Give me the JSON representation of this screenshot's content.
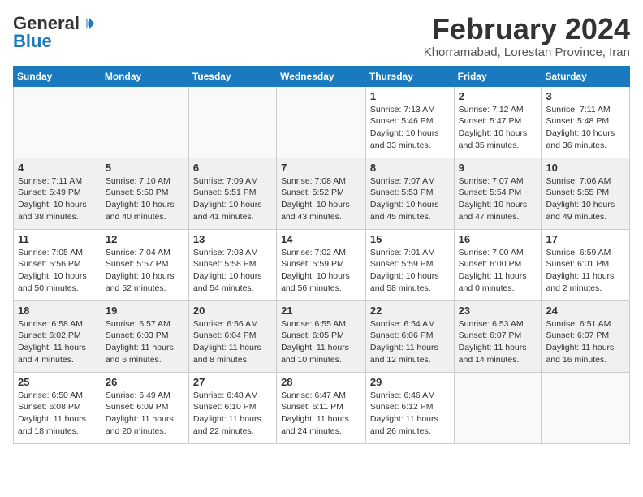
{
  "header": {
    "logo_line1": "General",
    "logo_line2": "Blue",
    "month_year": "February 2024",
    "location": "Khorramabad, Lorestan Province, Iran"
  },
  "weekdays": [
    "Sunday",
    "Monday",
    "Tuesday",
    "Wednesday",
    "Thursday",
    "Friday",
    "Saturday"
  ],
  "weeks": [
    [
      {
        "day": "",
        "info": ""
      },
      {
        "day": "",
        "info": ""
      },
      {
        "day": "",
        "info": ""
      },
      {
        "day": "",
        "info": ""
      },
      {
        "day": "1",
        "info": "Sunrise: 7:13 AM\nSunset: 5:46 PM\nDaylight: 10 hours\nand 33 minutes."
      },
      {
        "day": "2",
        "info": "Sunrise: 7:12 AM\nSunset: 5:47 PM\nDaylight: 10 hours\nand 35 minutes."
      },
      {
        "day": "3",
        "info": "Sunrise: 7:11 AM\nSunset: 5:48 PM\nDaylight: 10 hours\nand 36 minutes."
      }
    ],
    [
      {
        "day": "4",
        "info": "Sunrise: 7:11 AM\nSunset: 5:49 PM\nDaylight: 10 hours\nand 38 minutes."
      },
      {
        "day": "5",
        "info": "Sunrise: 7:10 AM\nSunset: 5:50 PM\nDaylight: 10 hours\nand 40 minutes."
      },
      {
        "day": "6",
        "info": "Sunrise: 7:09 AM\nSunset: 5:51 PM\nDaylight: 10 hours\nand 41 minutes."
      },
      {
        "day": "7",
        "info": "Sunrise: 7:08 AM\nSunset: 5:52 PM\nDaylight: 10 hours\nand 43 minutes."
      },
      {
        "day": "8",
        "info": "Sunrise: 7:07 AM\nSunset: 5:53 PM\nDaylight: 10 hours\nand 45 minutes."
      },
      {
        "day": "9",
        "info": "Sunrise: 7:07 AM\nSunset: 5:54 PM\nDaylight: 10 hours\nand 47 minutes."
      },
      {
        "day": "10",
        "info": "Sunrise: 7:06 AM\nSunset: 5:55 PM\nDaylight: 10 hours\nand 49 minutes."
      }
    ],
    [
      {
        "day": "11",
        "info": "Sunrise: 7:05 AM\nSunset: 5:56 PM\nDaylight: 10 hours\nand 50 minutes."
      },
      {
        "day": "12",
        "info": "Sunrise: 7:04 AM\nSunset: 5:57 PM\nDaylight: 10 hours\nand 52 minutes."
      },
      {
        "day": "13",
        "info": "Sunrise: 7:03 AM\nSunset: 5:58 PM\nDaylight: 10 hours\nand 54 minutes."
      },
      {
        "day": "14",
        "info": "Sunrise: 7:02 AM\nSunset: 5:59 PM\nDaylight: 10 hours\nand 56 minutes."
      },
      {
        "day": "15",
        "info": "Sunrise: 7:01 AM\nSunset: 5:59 PM\nDaylight: 10 hours\nand 58 minutes."
      },
      {
        "day": "16",
        "info": "Sunrise: 7:00 AM\nSunset: 6:00 PM\nDaylight: 11 hours\nand 0 minutes."
      },
      {
        "day": "17",
        "info": "Sunrise: 6:59 AM\nSunset: 6:01 PM\nDaylight: 11 hours\nand 2 minutes."
      }
    ],
    [
      {
        "day": "18",
        "info": "Sunrise: 6:58 AM\nSunset: 6:02 PM\nDaylight: 11 hours\nand 4 minutes."
      },
      {
        "day": "19",
        "info": "Sunrise: 6:57 AM\nSunset: 6:03 PM\nDaylight: 11 hours\nand 6 minutes."
      },
      {
        "day": "20",
        "info": "Sunrise: 6:56 AM\nSunset: 6:04 PM\nDaylight: 11 hours\nand 8 minutes."
      },
      {
        "day": "21",
        "info": "Sunrise: 6:55 AM\nSunset: 6:05 PM\nDaylight: 11 hours\nand 10 minutes."
      },
      {
        "day": "22",
        "info": "Sunrise: 6:54 AM\nSunset: 6:06 PM\nDaylight: 11 hours\nand 12 minutes."
      },
      {
        "day": "23",
        "info": "Sunrise: 6:53 AM\nSunset: 6:07 PM\nDaylight: 11 hours\nand 14 minutes."
      },
      {
        "day": "24",
        "info": "Sunrise: 6:51 AM\nSunset: 6:07 PM\nDaylight: 11 hours\nand 16 minutes."
      }
    ],
    [
      {
        "day": "25",
        "info": "Sunrise: 6:50 AM\nSunset: 6:08 PM\nDaylight: 11 hours\nand 18 minutes."
      },
      {
        "day": "26",
        "info": "Sunrise: 6:49 AM\nSunset: 6:09 PM\nDaylight: 11 hours\nand 20 minutes."
      },
      {
        "day": "27",
        "info": "Sunrise: 6:48 AM\nSunset: 6:10 PM\nDaylight: 11 hours\nand 22 minutes."
      },
      {
        "day": "28",
        "info": "Sunrise: 6:47 AM\nSunset: 6:11 PM\nDaylight: 11 hours\nand 24 minutes."
      },
      {
        "day": "29",
        "info": "Sunrise: 6:46 AM\nSunset: 6:12 PM\nDaylight: 11 hours\nand 26 minutes."
      },
      {
        "day": "",
        "info": ""
      },
      {
        "day": "",
        "info": ""
      }
    ]
  ]
}
